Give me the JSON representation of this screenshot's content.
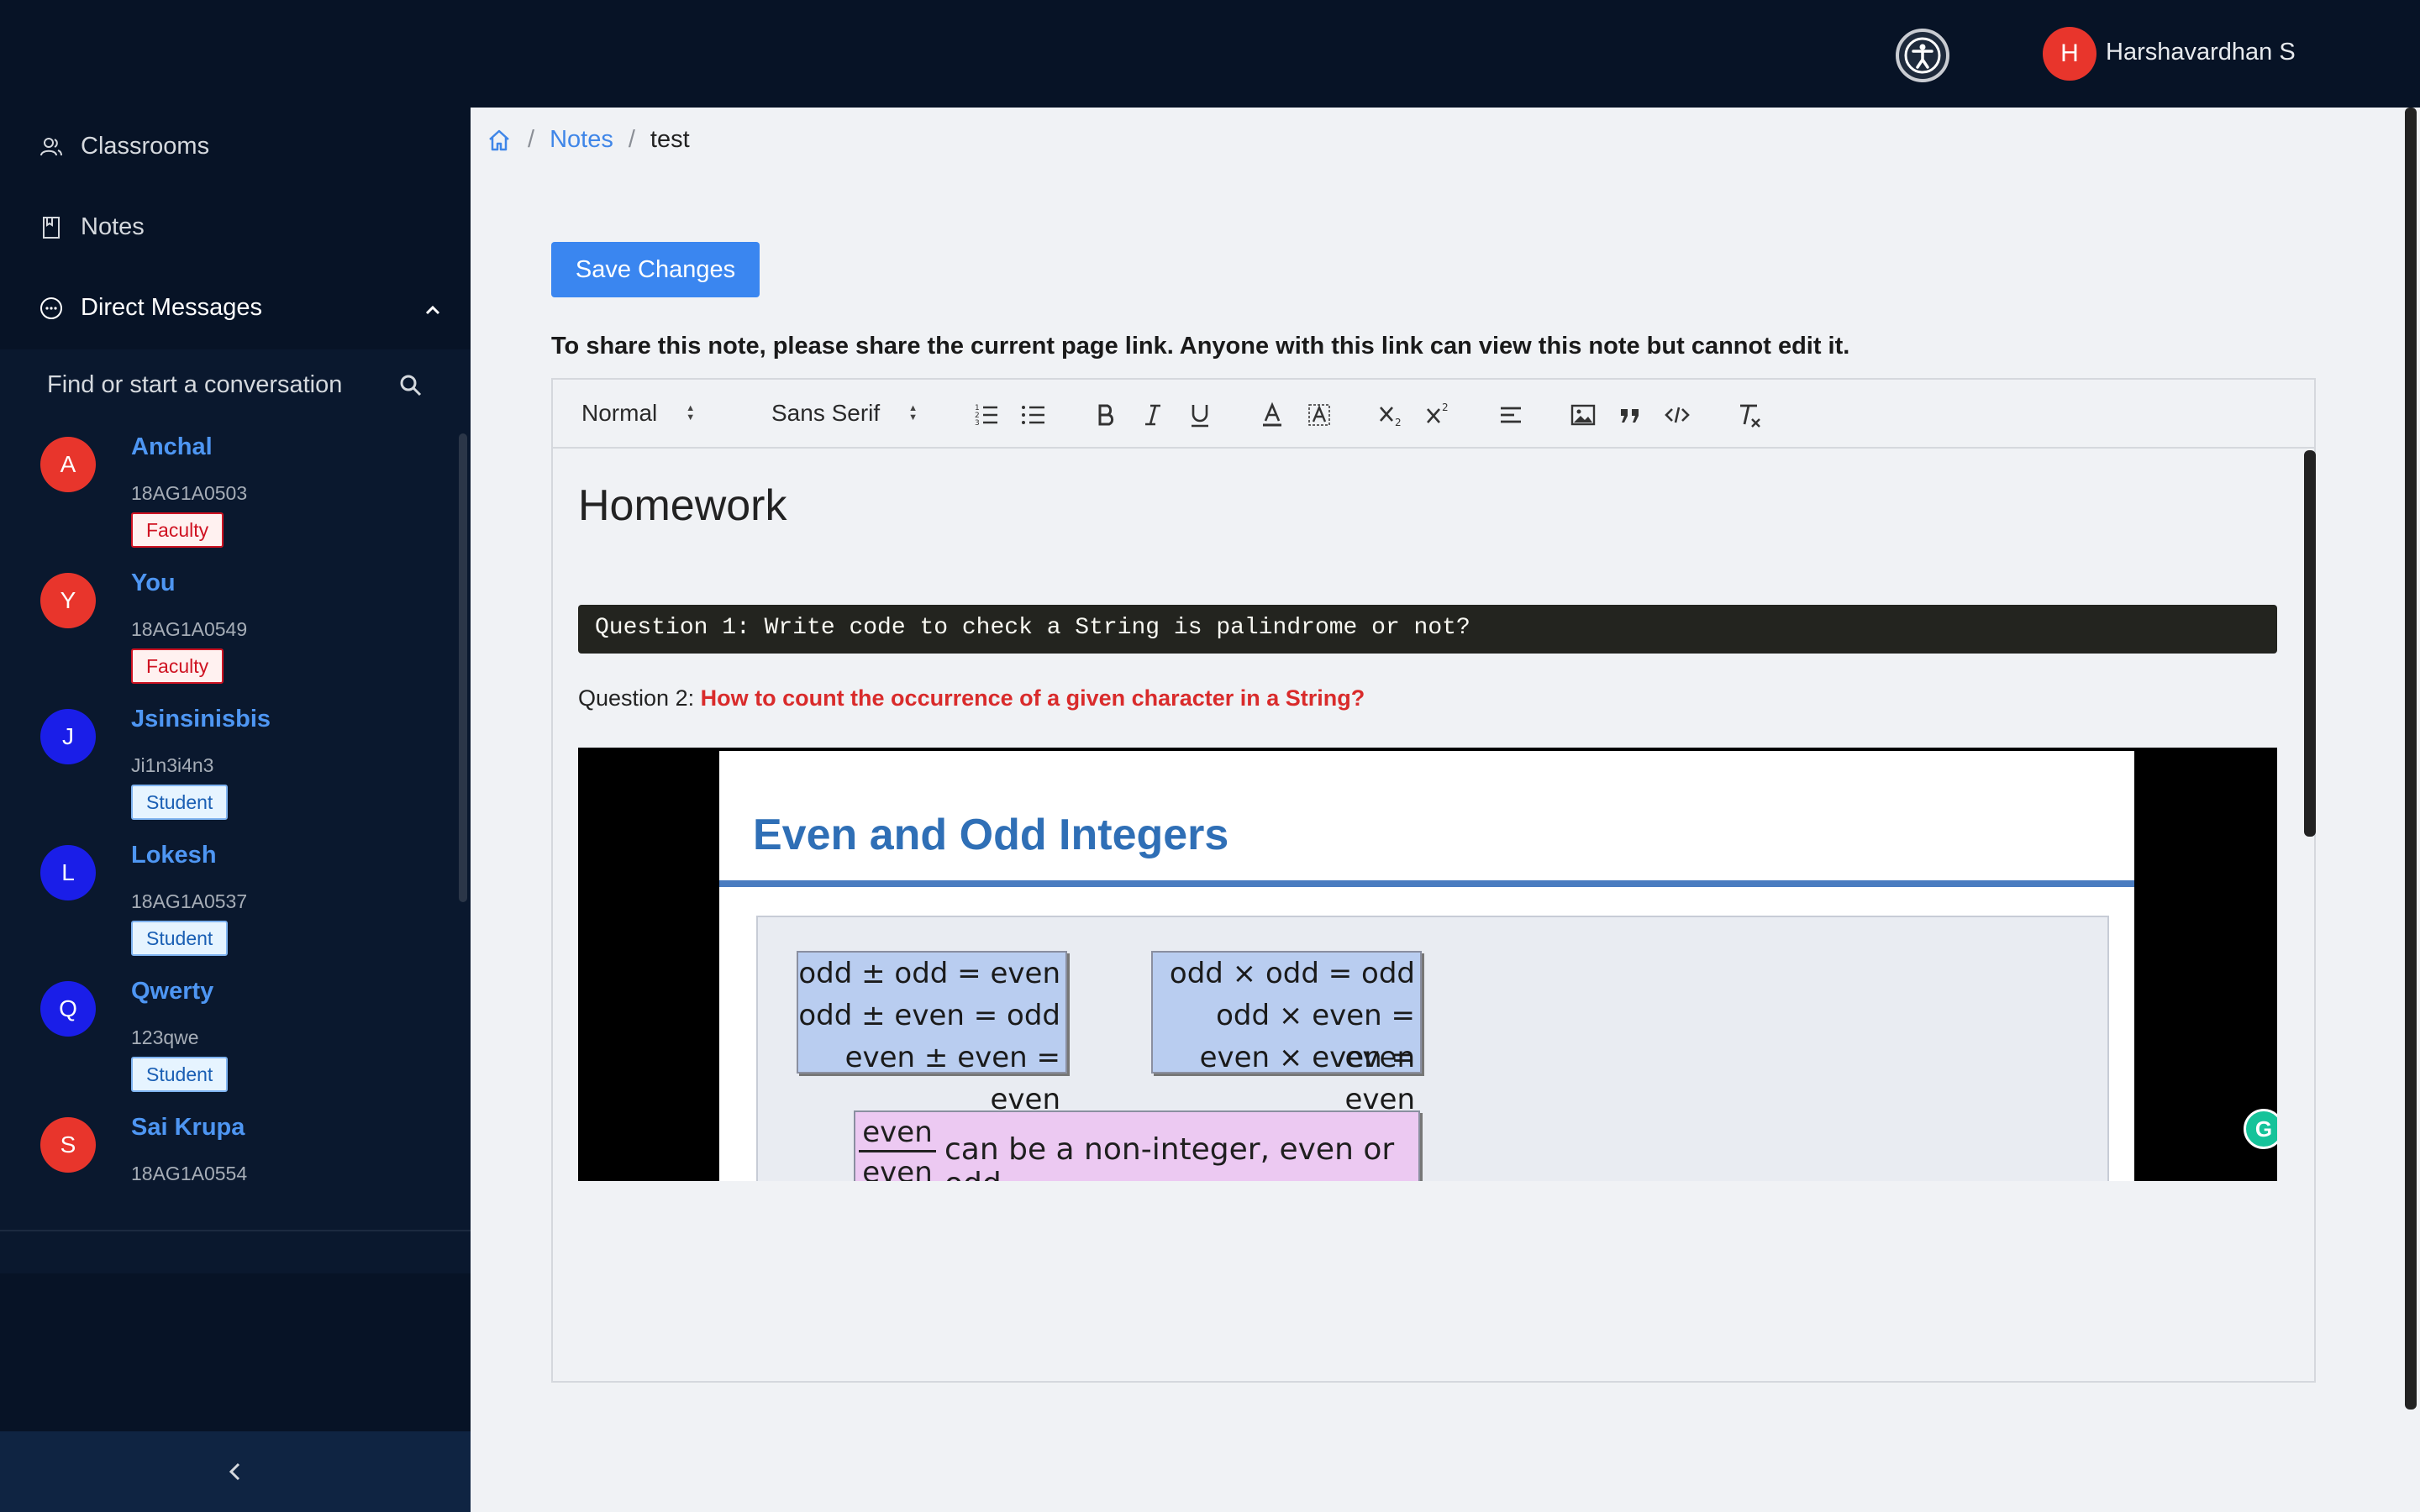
{
  "header": {
    "user_initial": "H",
    "user_name": "Harshavardhan S"
  },
  "sidebar": {
    "nav": [
      {
        "label": "Classrooms",
        "icon": "users-icon"
      },
      {
        "label": "Notes",
        "icon": "book-icon"
      },
      {
        "label": "Direct Messages",
        "icon": "chat-icon"
      }
    ],
    "dm_search_placeholder": "Find or start a conversation",
    "contacts": [
      {
        "initial": "A",
        "name": "Anchal",
        "id": "18AG1A0503",
        "role": "Faculty",
        "color": "#e8352c"
      },
      {
        "initial": "Y",
        "name": "You",
        "id": "18AG1A0549",
        "role": "Faculty",
        "color": "#e8352c"
      },
      {
        "initial": "J",
        "name": "Jsinsinisbis",
        "id": "Ji1n3i4n3",
        "role": "Student",
        "color": "#1a1ee8"
      },
      {
        "initial": "L",
        "name": "Lokesh",
        "id": "18AG1A0537",
        "role": "Student",
        "color": "#1a1ee8"
      },
      {
        "initial": "Q",
        "name": "Qwerty",
        "id": "123qwe",
        "role": "Student",
        "color": "#1a1ee8"
      },
      {
        "initial": "S",
        "name": "Sai Krupa",
        "id": "18AG1A0554",
        "role": "",
        "color": "#e8352c"
      }
    ]
  },
  "breadcrumb": {
    "section": "Notes",
    "current": "test"
  },
  "main": {
    "save_label": "Save Changes",
    "share_note": "To share this note, please share the current page link. Anyone with this link can view this note but cannot edit it."
  },
  "toolbar": {
    "heading_value": "Normal",
    "font_value": "Sans Serif"
  },
  "document": {
    "heading": "Homework",
    "code_line": "Question 1: Write code to check a String is palindrome or not?",
    "q2_prefix": "Question 2: ",
    "q2_text": "How to count the occurrence of a given character in a String?",
    "video": {
      "slide_title": "Even and Odd Integers",
      "add_rules": [
        "odd ± odd = even",
        "odd ± even = odd",
        "even ± even = even"
      ],
      "mul_rules": [
        "odd × odd = odd",
        "odd × even = even",
        "even × even = even"
      ],
      "frac_num": "even",
      "frac_den": "even",
      "div_rule": "can be a non-integer, even or odd"
    }
  }
}
